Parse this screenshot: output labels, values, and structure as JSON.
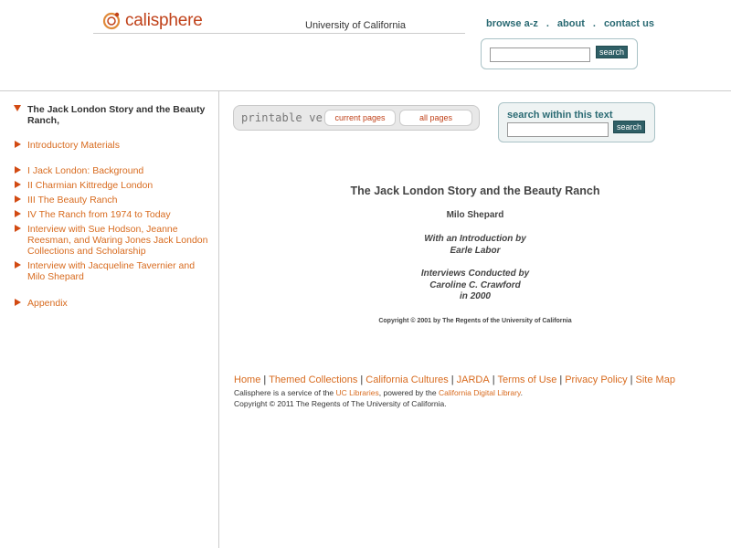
{
  "header": {
    "logo_text": "calisphere",
    "uc_text": "University of California",
    "nav": [
      "browse a-z",
      "about",
      "contact us"
    ],
    "nav_sep": ".",
    "search_button": "search"
  },
  "sidebar": {
    "title": "The Jack London Story and the Beauty Ranch,",
    "items": [
      {
        "label": "Introductory Materials"
      },
      {
        "label": "I Jack London: Background"
      },
      {
        "label": "II Charmian Kittredge London"
      },
      {
        "label": "III The Beauty Ranch"
      },
      {
        "label": "IV The Ranch from 1974 to Today"
      },
      {
        "label": "Interview with Sue Hodson, Jeanne Reesman, and Waring Jones  Jack London Collections and Scholarship"
      },
      {
        "label": "Interview with Jacqueline Tavernier and Milo Shepard"
      },
      {
        "label": "Appendix"
      }
    ]
  },
  "printable": {
    "label": "printable version",
    "current": "current pages",
    "all": "all pages"
  },
  "within": {
    "label": "search within this text",
    "button": "search"
  },
  "main": {
    "title": "The Jack London Story and the Beauty Ranch",
    "author": "Milo Shepard",
    "intro_line1": "With an Introduction by",
    "intro_line2": "Earle Labor",
    "interv_line1": "Interviews Conducted by",
    "interv_line2": "Caroline C. Crawford",
    "interv_line3": "in 2000",
    "copyright": "Copyright © 2001 by The Regents of the University of California"
  },
  "footer": {
    "links": [
      "Home",
      "Themed Collections",
      "California Cultures",
      "JARDA",
      "Terms of Use",
      "Privacy Policy",
      "Site Map"
    ],
    "sep": "|",
    "service_prefix": "Calisphere is a service of the ",
    "uc_libraries": "UC Libraries",
    "service_mid": ", powered by the ",
    "cdl": "California Digital Library",
    "service_suffix": ".",
    "copyright": "Copyright © 2011 The Regents of The University of California."
  },
  "colors": {
    "accent_orange": "#d86b1f",
    "teal": "#2a6a73"
  }
}
